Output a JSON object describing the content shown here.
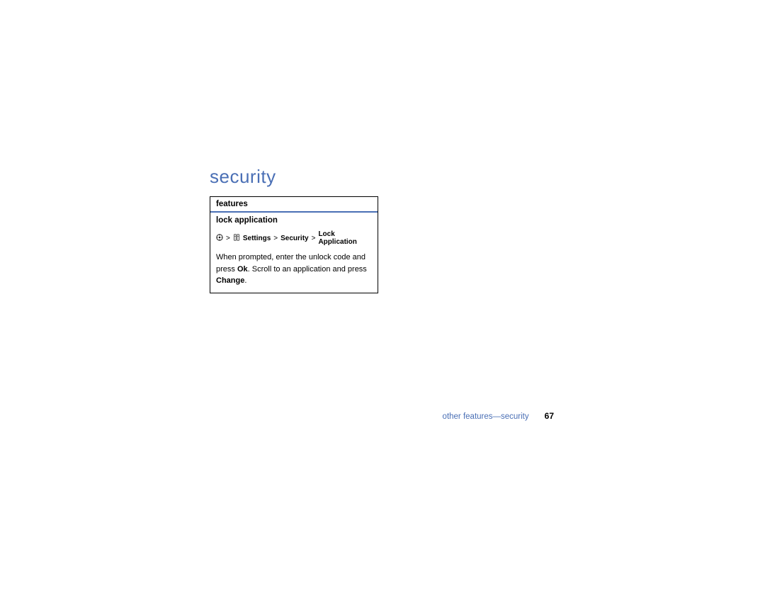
{
  "section": {
    "title": "security"
  },
  "table": {
    "header": "features",
    "feature_name": "lock application",
    "nav": {
      "separator": ">",
      "path1": "Settings",
      "path2": "Security",
      "path3": "Lock Application"
    },
    "description": {
      "part1": "When prompted, enter the unlock code and press ",
      "ok": "Ok",
      "part2": ". Scroll to an application and press ",
      "change": "Change",
      "part3": "."
    }
  },
  "footer": {
    "text": "other features—security",
    "page": "67"
  }
}
